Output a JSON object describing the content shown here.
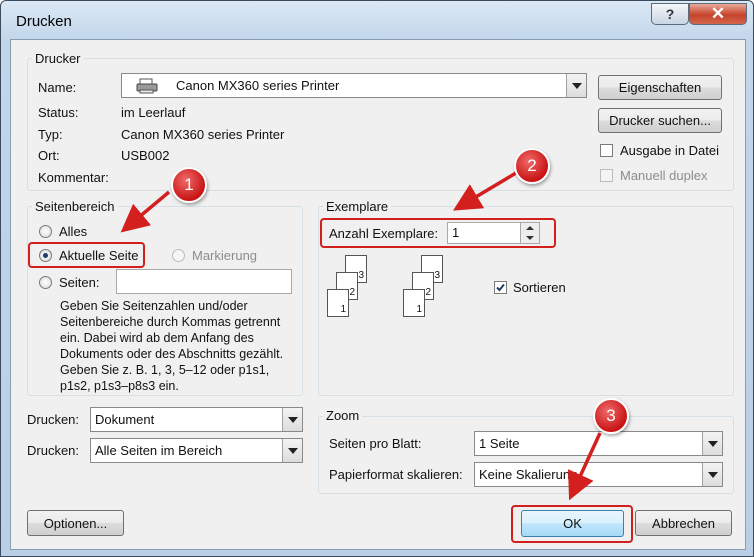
{
  "window": {
    "title": "Drucken",
    "help_glyph": "?",
    "close_glyph": "✕"
  },
  "printer": {
    "group_label": "Drucker",
    "name_label": "Name:",
    "name_value": "Canon MX360 series Printer",
    "status_label": "Status:",
    "status_value": "im Leerlauf",
    "type_label": "Typ:",
    "type_value": "Canon MX360 series Printer",
    "location_label": "Ort:",
    "location_value": "USB002",
    "comment_label": "Kommentar:",
    "properties_button": "Eigenschaften",
    "find_printer_button": "Drucker suchen...",
    "print_to_file_label": "Ausgabe in Datei",
    "manual_duplex_label": "Manuell duplex"
  },
  "page_range": {
    "group_label": "Seitenbereich",
    "all_label": "Alles",
    "current_page_label": "Aktuelle Seite",
    "selection_label": "Markierung",
    "pages_label": "Seiten:",
    "pages_value": "",
    "help_text": "Geben Sie Seitenzahlen und/oder Seitenbereiche durch Kommas getrennt ein. Dabei wird ab dem Anfang des Dokuments oder des Abschnitts gezählt. Geben Sie z. B. 1, 3, 5–12 oder p1s1, p1s2, p1s3–p8s3 ein.",
    "selected": "current_page"
  },
  "copies": {
    "group_label": "Exemplare",
    "count_label": "Anzahl Exemplare:",
    "count_value": "1",
    "collate_label": "Sortieren",
    "collate_checked": true,
    "page_numbers": [
      "1",
      "2",
      "3"
    ]
  },
  "print_what": {
    "label": "Drucken:",
    "value": "Dokument"
  },
  "print_range": {
    "label": "Drucken:",
    "value": "Alle Seiten im Bereich"
  },
  "zoom": {
    "group_label": "Zoom",
    "pages_per_sheet_label": "Seiten pro Blatt:",
    "pages_per_sheet_value": "1 Seite",
    "scale_label": "Papierformat skalieren:",
    "scale_value": "Keine Skalierung"
  },
  "footer": {
    "options_button": "Optionen...",
    "ok_button": "OK",
    "cancel_button": "Abbrechen"
  },
  "callouts": [
    "1",
    "2",
    "3"
  ],
  "colors": {
    "callout_red": "#d41f1f",
    "close_red": "#c6432b"
  }
}
